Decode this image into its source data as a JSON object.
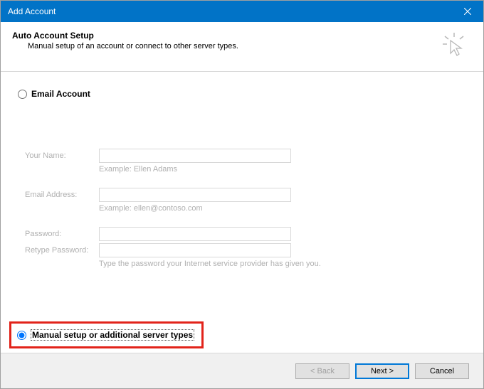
{
  "titlebar": {
    "title": "Add Account"
  },
  "header": {
    "title": "Auto Account Setup",
    "subtitle": "Manual setup of an account or connect to other server types."
  },
  "options": {
    "email_account": {
      "label": "Email Account",
      "selected": false
    },
    "manual_setup": {
      "label": "Manual setup or additional server types",
      "selected": true
    }
  },
  "form": {
    "your_name": {
      "label": "Your Name:",
      "value": "",
      "hint": "Example: Ellen Adams"
    },
    "email": {
      "label": "Email Address:",
      "value": "",
      "hint": "Example: ellen@contoso.com"
    },
    "password": {
      "label": "Password:",
      "value": ""
    },
    "retype_password": {
      "label": "Retype Password:",
      "value": "",
      "hint": "Type the password your Internet service provider has given you."
    }
  },
  "footer": {
    "back": "< Back",
    "next": "Next >",
    "cancel": "Cancel"
  }
}
